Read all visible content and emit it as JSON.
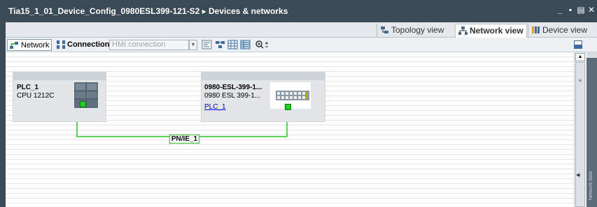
{
  "window": {
    "title": "Tia15_1_01_Device_Config_0980ESL399-121-S2 ▸ Devices & networks",
    "controls": [
      "_",
      "▪",
      "▤",
      "✕"
    ]
  },
  "view_tabs": [
    {
      "label": "Topology view",
      "icon": "topology-icon",
      "active": false
    },
    {
      "label": "Network view",
      "icon": "network-icon",
      "active": true
    },
    {
      "label": "Device view",
      "icon": "device-icon",
      "active": false
    }
  ],
  "toolbar": {
    "network_label": "Network",
    "connections_label": "Connections",
    "connection_type_value": "HMI connection"
  },
  "canvas": {
    "devices": [
      {
        "name": "PLC_1",
        "type": "CPU 1212C"
      },
      {
        "name": "0980-ESL-399-1...",
        "type": "0980 ESL 399-1...",
        "link": "PLC_1"
      }
    ],
    "subnet_label": "PN/IE_1"
  },
  "side_panel": {
    "label": "Network data"
  },
  "colors": {
    "titlebar": "#3b4a57",
    "network_line": "#2fbf2f",
    "port_green": "#22cc22",
    "link_blue": "#0000cc"
  }
}
